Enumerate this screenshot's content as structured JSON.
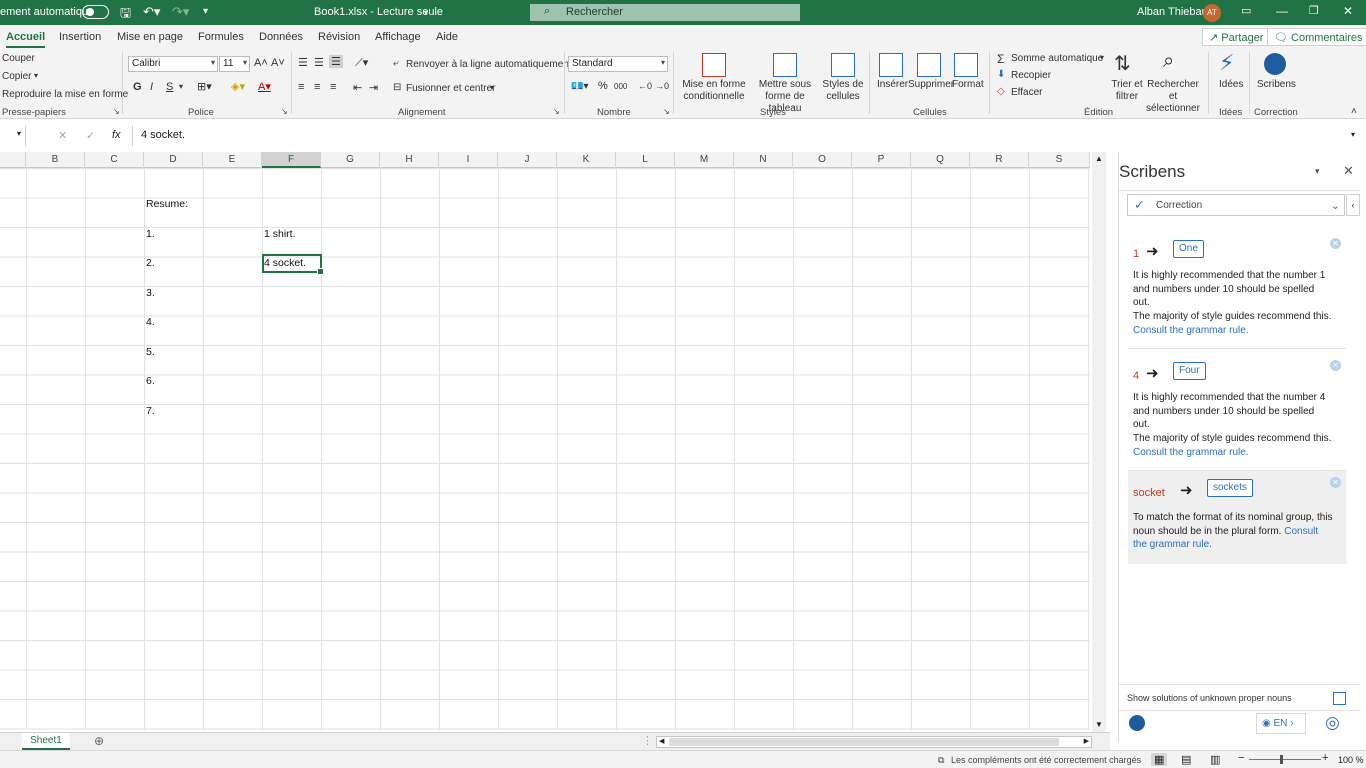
{
  "titlebar": {
    "autosave_label": "ement automatique",
    "file_title": "Book1.xlsx  -  Lecture seule",
    "search_placeholder": "Rechercher",
    "user_name": "Alban Thiebaut",
    "user_initials": "AT"
  },
  "tabs": [
    "Accueil",
    "Insertion",
    "Mise en page",
    "Formules",
    "Données",
    "Révision",
    "Affichage",
    "Aide"
  ],
  "active_tab": "Accueil",
  "share_button": "Partager",
  "comments_button": "Commentaires",
  "ribbon": {
    "clipboard": {
      "cut": "Couper",
      "copy": "Copier",
      "format_painter": "Reproduire la mise en forme",
      "group": "Presse-papiers"
    },
    "font": {
      "name": "Calibri",
      "size": "11",
      "bold": "G",
      "italic": "I",
      "underline": "S",
      "group": "Police"
    },
    "alignment": {
      "wrap": "Renvoyer à la ligne automatiquement",
      "merge": "Fusionner et centrer",
      "group": "Alignement"
    },
    "number": {
      "format": "Standard",
      "group": "Nombre"
    },
    "styles": {
      "conditional": "Mise en forme conditionnelle",
      "table": "Mettre sous forme de tableau",
      "cell_styles": "Styles de cellules",
      "group": "Styles"
    },
    "cells": {
      "insert": "Insérer",
      "delete": "Supprimer",
      "format": "Format",
      "group": "Cellules"
    },
    "editing": {
      "autosum": "Somme automatique",
      "fill": "Recopier",
      "clear": "Effacer",
      "sort": "Trier et filtrer",
      "find": "Rechercher et sélectionner",
      "group": "Édition"
    },
    "ideas": {
      "label": "Idées",
      "group": "Idées"
    },
    "scribens": {
      "label": "Scribens",
      "group": "Correction"
    }
  },
  "formula_bar": {
    "fx": "fx",
    "value": "4 socket."
  },
  "columns": [
    "B",
    "C",
    "D",
    "E",
    "F",
    "G",
    "H",
    "I",
    "J",
    "K",
    "L",
    "M",
    "N",
    "O",
    "P",
    "Q",
    "R",
    "S"
  ],
  "selected_column": "F",
  "cells": {
    "resume": "Resume:",
    "n1": "1.",
    "n2": "2.",
    "n3": "3.",
    "n4": "4.",
    "n5": "5.",
    "n6": "6.",
    "n7": "7.",
    "f1": "1 shirt.",
    "f2": "4 socket."
  },
  "sheet_tab": "Sheet1",
  "status": {
    "addins": "Les compléments ont été correctement chargés",
    "zoom": "100 %"
  },
  "pane": {
    "title": "Scribens",
    "mode": "Correction",
    "suggestions": [
      {
        "original": "1",
        "replacement": "One",
        "message": "It is highly recommended that the number 1 and numbers under 10 should be spelled out.",
        "message2": "The majority of style guides recommend this.",
        "link": "Consult the grammar rule."
      },
      {
        "original": "4",
        "replacement": "Four",
        "message": "It is highly recommended that the number 4 and numbers under 10 should be spelled out.",
        "message2": "The majority of style guides recommend this.",
        "link": "Consult the grammar rule."
      },
      {
        "original": "socket",
        "replacement": "sockets",
        "message": "To match the format of its nominal group, this noun should be in the plural form.",
        "message2": "",
        "link": "Consult the grammar rule."
      }
    ],
    "proper_nouns_label": "Show solutions of unknown proper nouns",
    "language": "EN"
  }
}
